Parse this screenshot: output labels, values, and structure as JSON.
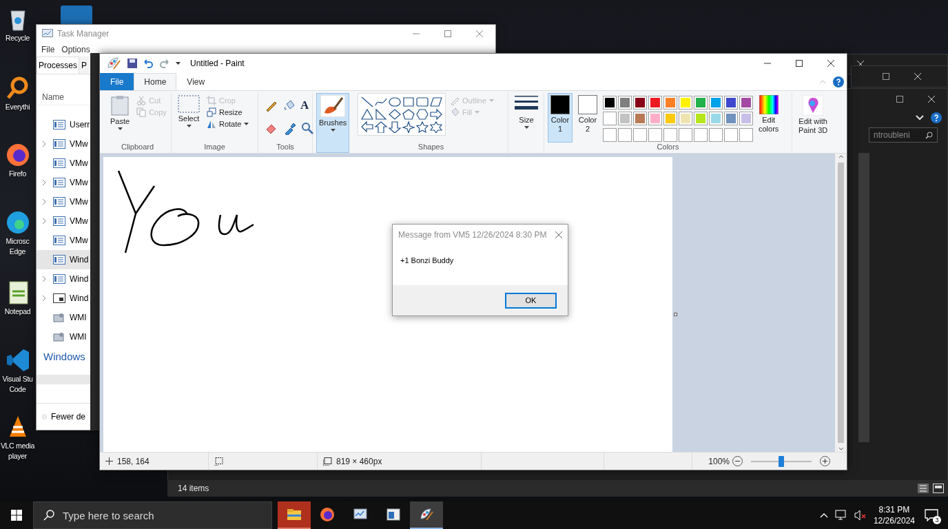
{
  "desktop_icons": [
    {
      "kind": "recycle",
      "lines": [
        "Recycle"
      ]
    },
    {
      "kind": "search",
      "lines": [
        "Everythi"
      ]
    },
    {
      "kind": "firefox",
      "lines": [
        "Firefo"
      ]
    },
    {
      "kind": "edge",
      "lines": [
        "Microsc",
        "Edge"
      ]
    },
    {
      "kind": "notepad",
      "lines": [
        "Notepad"
      ]
    },
    {
      "kind": "vscode",
      "lines": [
        "Visual Stu",
        "Code"
      ]
    },
    {
      "kind": "vlc",
      "lines": [
        "VLC media",
        "player"
      ]
    }
  ],
  "task_manager": {
    "title": "Task Manager",
    "menu": [
      "File",
      "Options"
    ],
    "tabs": [
      {
        "label": "Processes",
        "selected": true
      },
      {
        "label": "P",
        "selected": false
      }
    ],
    "column": "Name",
    "rows": [
      {
        "label": "Userr",
        "expandable": false,
        "selected": false,
        "kind": "app"
      },
      {
        "label": "VMw",
        "expandable": true,
        "selected": false,
        "kind": "app"
      },
      {
        "label": "VMw",
        "expandable": false,
        "selected": false,
        "kind": "app"
      },
      {
        "label": "VMw",
        "expandable": true,
        "selected": false,
        "kind": "app"
      },
      {
        "label": "VMw",
        "expandable": true,
        "selected": false,
        "kind": "app"
      },
      {
        "label": "VMw",
        "expandable": true,
        "selected": false,
        "kind": "app"
      },
      {
        "label": "VMw",
        "expandable": false,
        "selected": false,
        "kind": "app"
      },
      {
        "label": "Wind",
        "expandable": false,
        "selected": true,
        "kind": "app"
      },
      {
        "label": "Wind",
        "expandable": true,
        "selected": false,
        "kind": "app"
      },
      {
        "label": "Wind",
        "expandable": true,
        "selected": false,
        "kind": "window"
      },
      {
        "label": "WMI",
        "expandable": false,
        "selected": false,
        "kind": "service"
      },
      {
        "label": "WMI",
        "expandable": false,
        "selected": false,
        "kind": "service"
      }
    ],
    "group_heading": "Windows",
    "footer": "Fewer de"
  },
  "paint": {
    "title": "Untitled - Paint",
    "ribbon_tabs": [
      {
        "label": "File",
        "kind": "file",
        "selected": false
      },
      {
        "label": "Home",
        "kind": "tab",
        "selected": true
      },
      {
        "label": "View",
        "kind": "tab",
        "selected": false
      }
    ],
    "clipboard": {
      "paste": "Paste",
      "cut": {
        "label": "Cut",
        "disabled": true
      },
      "copy": {
        "label": "Copy",
        "disabled": true
      },
      "label": "Clipboard"
    },
    "image": {
      "select": "Select",
      "crop": {
        "label": "Crop",
        "disabled": true
      },
      "resize": {
        "label": "Resize",
        "disabled": false
      },
      "rotate": {
        "label": "Rotate",
        "disabled": false
      },
      "label": "Image"
    },
    "tools": {
      "label": "Tools",
      "text_tool": "A"
    },
    "brushes": {
      "label": "Brushes",
      "selected": true
    },
    "shapes": {
      "outline": {
        "label": "Outline",
        "disabled": true
      },
      "fill": {
        "label": "Fill",
        "disabled": true
      },
      "label": "Shapes"
    },
    "size": {
      "label": "Size"
    },
    "color1": {
      "lines": [
        "Color",
        "1"
      ],
      "color": "#000000",
      "selected": true
    },
    "color2": {
      "lines": [
        "Color",
        "2"
      ],
      "color": "#ffffff",
      "selected": false
    },
    "palette": [
      {
        "kind": "swatch",
        "color": "#000000"
      },
      {
        "kind": "swatch",
        "color": "#7f7f7f"
      },
      {
        "kind": "swatch",
        "color": "#880015"
      },
      {
        "kind": "swatch",
        "color": "#ed1c24"
      },
      {
        "kind": "swatch",
        "color": "#ff7f27"
      },
      {
        "kind": "swatch",
        "color": "#fff200"
      },
      {
        "kind": "swatch",
        "color": "#22b14c"
      },
      {
        "kind": "swatch",
        "color": "#00a2e8"
      },
      {
        "kind": "swatch",
        "color": "#3f48cc"
      },
      {
        "kind": "swatch",
        "color": "#a349a4"
      },
      {
        "kind": "swatch",
        "color": "#ffffff"
      },
      {
        "kind": "swatch",
        "color": "#c3c3c3"
      },
      {
        "kind": "swatch",
        "color": "#b97a57"
      },
      {
        "kind": "swatch",
        "color": "#ffaec9"
      },
      {
        "kind": "swatch",
        "color": "#ffc90e"
      },
      {
        "kind": "swatch",
        "color": "#efe4b0"
      },
      {
        "kind": "swatch",
        "color": "#b5e61d"
      },
      {
        "kind": "swatch",
        "color": "#99d9ea"
      },
      {
        "kind": "swatch",
        "color": "#7092be"
      },
      {
        "kind": "swatch",
        "color": "#c8bfe7"
      },
      {
        "kind": "empty"
      },
      {
        "kind": "empty"
      },
      {
        "kind": "empty"
      },
      {
        "kind": "empty"
      },
      {
        "kind": "empty"
      },
      {
        "kind": "empty"
      },
      {
        "kind": "empty"
      },
      {
        "kind": "empty"
      },
      {
        "kind": "empty"
      },
      {
        "kind": "empty"
      }
    ],
    "colors_label": "Colors",
    "edit_colors": [
      "Edit",
      "colors"
    ],
    "paint3d": [
      "Edit with",
      "Paint 3D"
    ],
    "status": {
      "cursor": "158, 164",
      "dimensions": "819 × 460px",
      "zoom": "100%",
      "zoom_slider": {
        "level": 0.5
      }
    }
  },
  "dialog": {
    "title": "Message from VM5 12/26/2024 8:30 PM",
    "message": "+1 Bonzi Buddy",
    "button": "OK"
  },
  "explorer": {
    "search_value": "ntroubleni",
    "status": "14 items"
  },
  "taskbar": {
    "search_placeholder": "Type here to search",
    "apps": [
      {
        "kind": "explorer",
        "selected": false,
        "flashing": true
      },
      {
        "kind": "firefox",
        "selected": false,
        "flashing": false
      },
      {
        "kind": "taskmgr",
        "selected": false,
        "flashing": false
      },
      {
        "kind": "window",
        "selected": false,
        "flashing": false
      },
      {
        "kind": "paint",
        "selected": true,
        "flashing": false
      }
    ],
    "time": "8:31 PM",
    "date": "12/26/2024",
    "notifications": "3"
  }
}
